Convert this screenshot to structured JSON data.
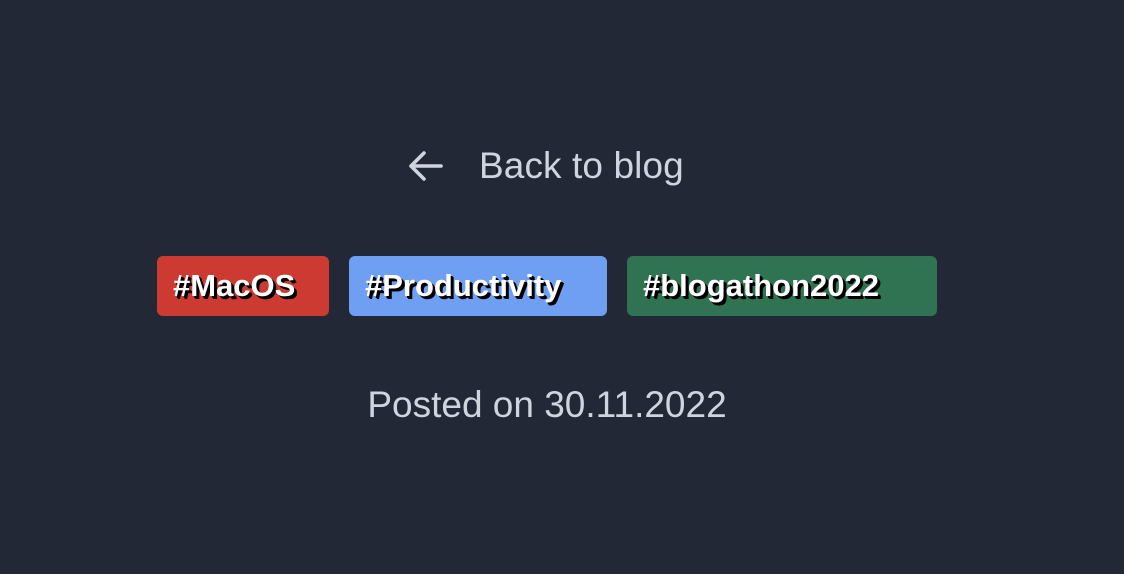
{
  "nav": {
    "back_label": "Back to blog",
    "back_icon": "arrow-left-icon"
  },
  "tags": [
    {
      "label": "#MacOS",
      "color": "#cd3a31"
    },
    {
      "label": "#Productivity",
      "color": "#6f9ff2"
    },
    {
      "label": "#blogathon2022",
      "color": "#2f7352"
    }
  ],
  "post": {
    "posted_text": "Posted on 30.11.2022"
  },
  "colors": {
    "background": "#222836",
    "text": "#cfd4de"
  }
}
